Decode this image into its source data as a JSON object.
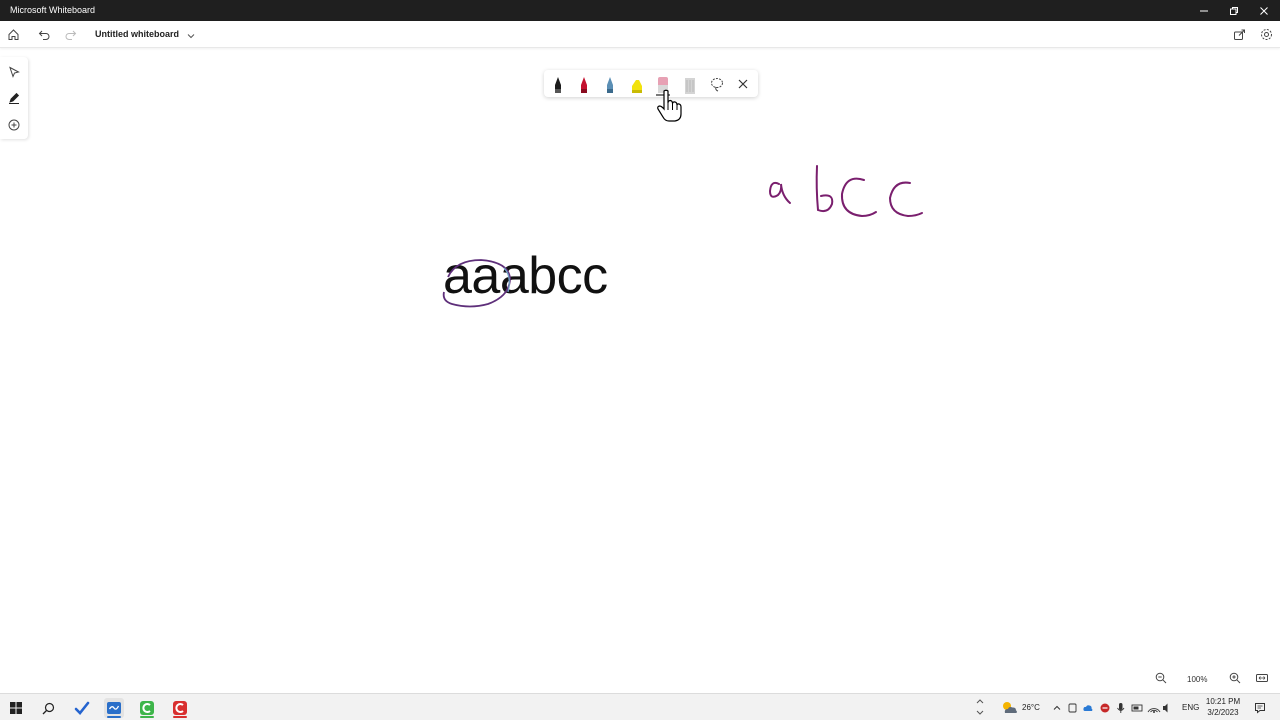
{
  "window": {
    "title": "Microsoft Whiteboard"
  },
  "appbar": {
    "doc_title": "Untitled whiteboard"
  },
  "canvas": {
    "typed_text": "aaabcc",
    "handwritten_text": "abcc",
    "ink_color": "#7a1f6e",
    "selection_circle_color": "#6a2a7a"
  },
  "ink_toolbar": {
    "tools": [
      {
        "name": "black-pen",
        "color": "#1b1b1b"
      },
      {
        "name": "red-pen",
        "color": "#c4122f"
      },
      {
        "name": "blue-pen",
        "color": "#5b8fb5"
      },
      {
        "name": "yellow-highlighter",
        "color": "#f2e20c"
      },
      {
        "name": "eraser",
        "color": "#e7a1b4",
        "selected": true
      },
      {
        "name": "ruler",
        "color": "#bdbdbd"
      }
    ]
  },
  "zoom": {
    "level": "100%"
  },
  "taskbar": {
    "weather_temp": "26°C",
    "language": "ENG",
    "time": "10:21 PM",
    "date": "3/2/2023"
  }
}
